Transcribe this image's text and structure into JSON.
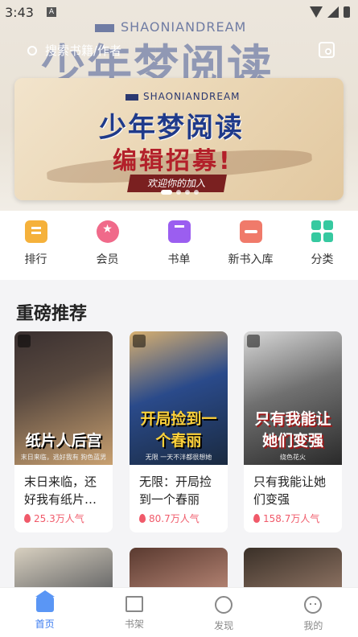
{
  "status_bar": {
    "time": "3:43",
    "notif_glyph": "A"
  },
  "header": {
    "brand_text": "SHAONIANDREAM",
    "hero_title": "少年梦阅读",
    "search_placeholder": "搜索书籍/作者",
    "search_icon": "search-icon",
    "history_icon": "reading-history-icon"
  },
  "banner": {
    "brand": "SHAONIANDREAM",
    "title": "少年梦阅读",
    "subtitle": "编辑招募!",
    "cta": "欢迎你的加入",
    "page_count": 4,
    "active_index": 0
  },
  "quick_menu": [
    {
      "label": "排行",
      "icon": "rank-icon"
    },
    {
      "label": "会员",
      "icon": "member-icon"
    },
    {
      "label": "书单",
      "icon": "booklist-icon"
    },
    {
      "label": "新书入库",
      "icon": "new-books-icon"
    },
    {
      "label": "分类",
      "icon": "category-icon"
    }
  ],
  "recommend": {
    "title": "重磅推荐",
    "books": [
      {
        "cover_title": "纸片人后宫",
        "cover_sub": "末日来临，逃好我有",
        "cover_author": "狗色蓝男",
        "name": "末日来临，还好我有纸片…",
        "popularity": "25.3万人气"
      },
      {
        "cover_title": "开局捡到一个春丽",
        "cover_sub": "一天不泮都很想她",
        "cover_author": "无限",
        "name": "无限：开局捡到一个春丽",
        "popularity": "80.7万人气"
      },
      {
        "cover_title": "只有我能让她们变强",
        "cover_sub": "",
        "cover_author": "绕色花火",
        "name": "只有我能让她们变强",
        "popularity": "158.7万人气"
      }
    ]
  },
  "bottom_nav": [
    {
      "label": "首页",
      "icon": "home-icon",
      "active": true
    },
    {
      "label": "书架",
      "icon": "bookshelf-icon",
      "active": false
    },
    {
      "label": "发现",
      "icon": "discover-icon",
      "active": false
    },
    {
      "label": "我的",
      "icon": "profile-icon",
      "active": false
    }
  ],
  "colors": {
    "accent": "#3a7bf0",
    "popularity": "#f05a6a"
  }
}
